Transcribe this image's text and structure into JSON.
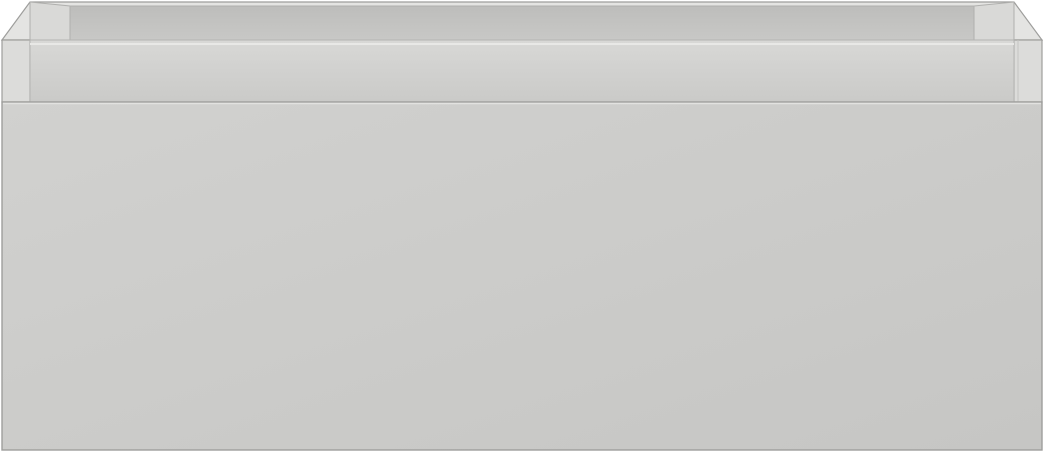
{
  "object": {
    "kind": "drawer-cabinet-render",
    "colors": {
      "background": "#ffffff",
      "front_panel_top": "#d1d1cf",
      "front_panel_bottom": "#c6c6c4",
      "inner_back_wall": "#c2c2c0",
      "inner_side_wall": "#d7d7d5",
      "rim_top": "#e6e6e4",
      "inner_drawer_face": "#cfcfcd",
      "edge_line": "#b4b4b2",
      "outline": "#9e9e9c"
    }
  }
}
